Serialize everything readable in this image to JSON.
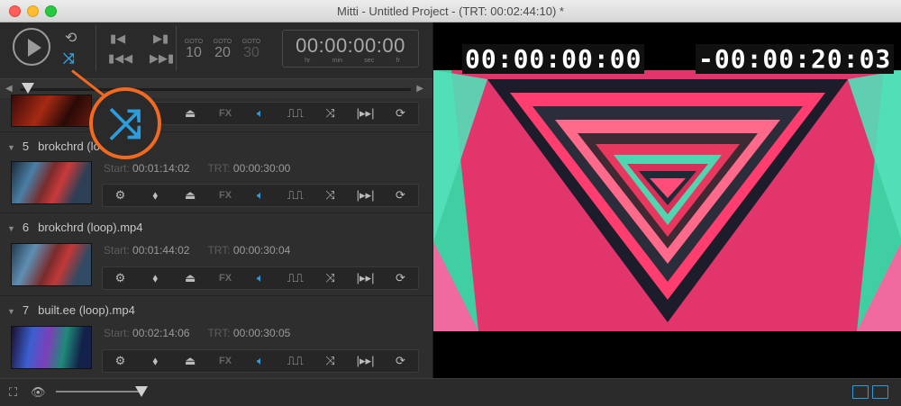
{
  "window": {
    "title": "Mitti - Untitled Project - (TRT: 00:02:44:10) *"
  },
  "transport": {
    "goto_label": "GOTO",
    "goto_buttons": [
      "10",
      "20",
      "30"
    ],
    "timecode": "00:00:00:00",
    "timecode_units": [
      "hr",
      "min",
      "sec",
      "fr"
    ]
  },
  "toolbar_labels": {
    "fx": "FX"
  },
  "cues": [
    {
      "number": "5",
      "name": "brokchrd (loop).mov",
      "start_label": "Start:",
      "start": "00:01:14:02",
      "trt_label": "TRT:",
      "trt": "00:00:30:00"
    },
    {
      "number": "6",
      "name": "brokchrd (loop).mp4",
      "start_label": "Start:",
      "start": "00:01:44:02",
      "trt_label": "TRT:",
      "trt": "00:00:30:04"
    },
    {
      "number": "7",
      "name": "built.ee (loop).mp4",
      "start_label": "Start:",
      "start": "00:02:14:06",
      "trt_label": "TRT:",
      "trt": "00:00:30:05"
    }
  ],
  "preview": {
    "elapsed": "00:00:00:00",
    "remaining": "-00:00:20:03"
  },
  "icons": {
    "play": "play-icon",
    "loop": "loop-icon",
    "shuffle": "shuffle-icon",
    "gear": "gear-icon",
    "tag": "tag-icon",
    "eject": "eject-icon",
    "volume": "volume-icon",
    "fade": "fade-icon",
    "nudge": "nudge-icon",
    "refresh": "refresh-icon"
  },
  "colors": {
    "accent": "#2d9cdb",
    "callout": "#f26a21"
  }
}
